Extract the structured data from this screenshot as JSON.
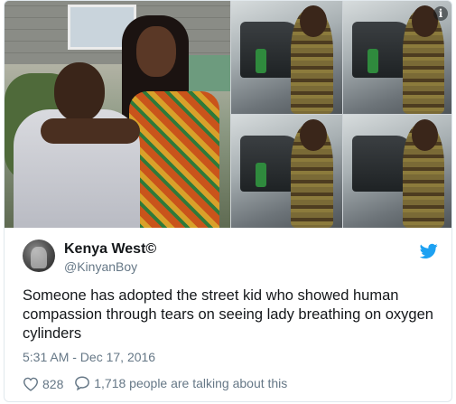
{
  "tweet": {
    "author_name": "Kenya West©",
    "author_handle": "@KinyanBoy",
    "text": "Someone has adopted the street kid who showed human compassion through tears on seeing lady breathing on oxygen cylinders",
    "timestamp": "5:31 AM - Dec 17, 2016",
    "likes": "828",
    "talking": "1,718 people are talking about this"
  },
  "icons": {
    "info": "info-icon",
    "brand": "twitter-bird-icon",
    "like": "heart-icon",
    "reply": "speech-bubble-icon"
  },
  "colors": {
    "twitter_blue": "#1da1f2",
    "muted": "#657786",
    "text": "#14171a",
    "border": "#e1e8ed"
  }
}
